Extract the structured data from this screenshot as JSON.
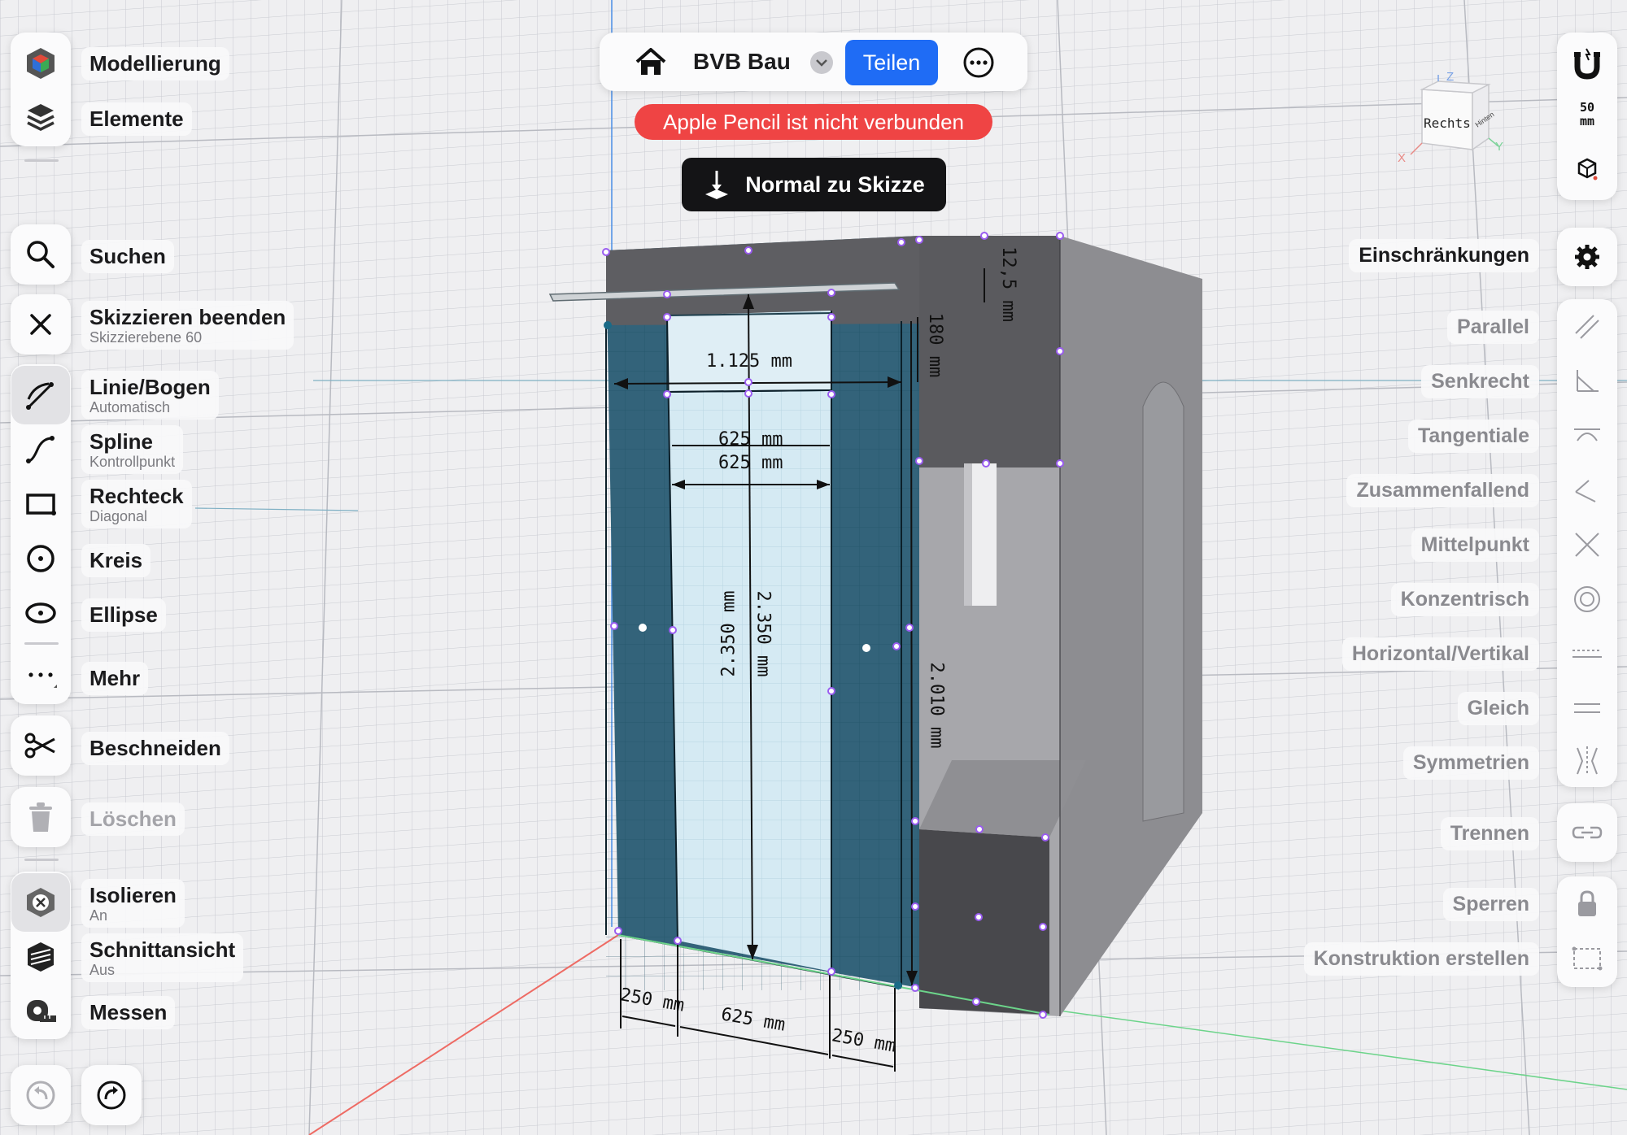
{
  "app": {
    "document_title": "BVB Bau",
    "share_label": "Teilen",
    "pencil_warning": "Apple Pencil ist nicht verbunden",
    "normal_to_sketch": "Normal zu Skizze"
  },
  "left_toolbar": {
    "workspace": [
      {
        "label": "Modellierung",
        "icon": "cube-color-icon"
      },
      {
        "label": "Elemente",
        "icon": "layers-icon"
      }
    ],
    "search": {
      "label": "Suchen"
    },
    "finish": {
      "label": "Skizzieren beenden",
      "sublabel": "Skizzierebene 60"
    },
    "sketch_tools": [
      {
        "label": "Linie/Bogen",
        "sublabel": "Automatisch",
        "icon": "line-arc-icon",
        "active": true
      },
      {
        "label": "Spline",
        "sublabel": "Kontrollpunkt",
        "icon": "spline-icon"
      },
      {
        "label": "Rechteck",
        "sublabel": "Diagonal",
        "icon": "rectangle-icon"
      },
      {
        "label": "Kreis",
        "sublabel": "",
        "icon": "circle-icon"
      },
      {
        "label": "Ellipse",
        "sublabel": "",
        "icon": "ellipse-icon"
      }
    ],
    "more": {
      "label": "Mehr"
    },
    "trim": {
      "label": "Beschneiden"
    },
    "delete": {
      "label": "Löschen"
    },
    "view_tools": [
      {
        "label": "Isolieren",
        "sublabel": "An",
        "icon": "isolate-icon"
      },
      {
        "label": "Schnittansicht",
        "sublabel": "Aus",
        "icon": "section-view-icon"
      },
      {
        "label": "Messen",
        "sublabel": "",
        "icon": "tape-measure-icon"
      }
    ]
  },
  "right_toolbar": {
    "grid_size": {
      "value": "50",
      "unit": "mm"
    },
    "constraints_title": "Einschränkungen",
    "constraints": [
      {
        "label": "Parallel",
        "icon": "parallel-icon"
      },
      {
        "label": "Senkrecht",
        "icon": "perpendicular-icon"
      },
      {
        "label": "Tangentiale",
        "icon": "tangent-icon"
      },
      {
        "label": "Zusammenfallend",
        "icon": "coincident-icon"
      },
      {
        "label": "Mittelpunkt",
        "icon": "midpoint-icon"
      },
      {
        "label": "Konzentrisch",
        "icon": "concentric-icon"
      },
      {
        "label": "Horizontal/Vertikal",
        "icon": "horizontal-vertical-icon"
      },
      {
        "label": "Gleich",
        "icon": "equal-icon"
      },
      {
        "label": "Symmetrien",
        "icon": "symmetry-icon"
      }
    ],
    "extra": [
      {
        "label": "Trennen",
        "icon": "split-icon"
      },
      {
        "label": "Sperren",
        "icon": "lock-icon"
      },
      {
        "label": "Konstruktion erstellen",
        "icon": "construction-icon"
      }
    ]
  },
  "view_cube": {
    "face_label": "Rechts",
    "side_label": "Hinten",
    "axis_x": "X",
    "axis_y": "Y",
    "axis_z": "Z"
  },
  "dimensions": {
    "top_width": "1.125 mm",
    "opening_width_1": "625 mm",
    "opening_width_2": "625 mm",
    "door_height_1": "2.350 mm",
    "door_height_2": "2.350 mm",
    "side_height": "2.010 mm",
    "lintel": "180 mm",
    "thickness": "12,5 mm",
    "bottom_left": "250 mm",
    "bottom_mid": "625 mm",
    "bottom_right": "250 mm"
  }
}
